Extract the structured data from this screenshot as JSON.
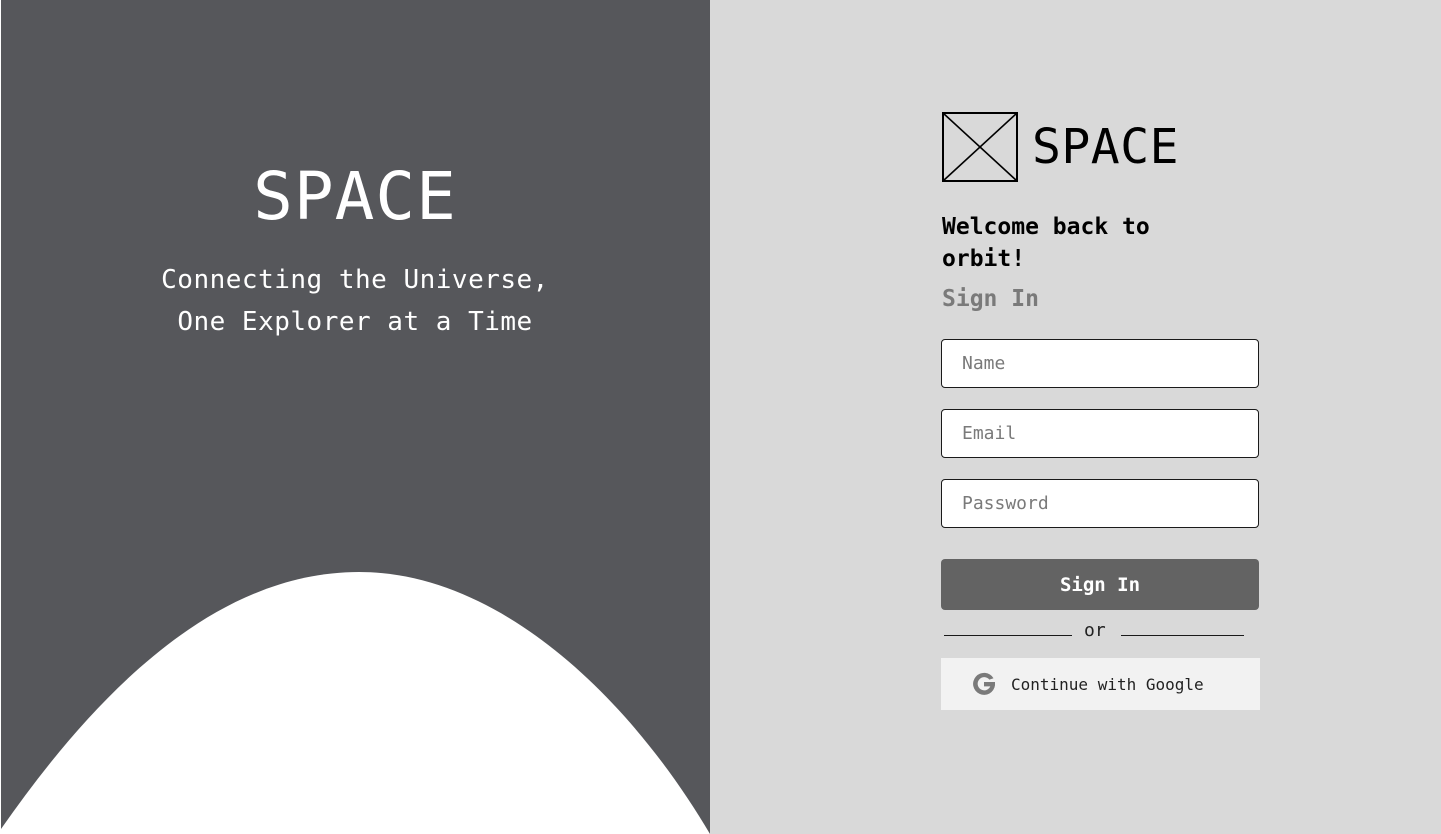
{
  "hero": {
    "title": "SPACE",
    "tagline_line1": "Connecting the Universe,",
    "tagline_line2": "One Explorer at a Time"
  },
  "brand": {
    "logo_icon": "image-placeholder-icon",
    "name": "SPACE"
  },
  "form": {
    "welcome": "Welcome back to orbit!",
    "heading": "Sign In",
    "name_placeholder": "Name",
    "email_placeholder": "Email",
    "password_placeholder": "Password",
    "submit_label": "Sign In",
    "divider_text": "or",
    "google_icon": "google-g-icon",
    "google_label": "Continue with Google"
  },
  "colors": {
    "left_panel": "#56575b",
    "right_panel": "#d9d9d9",
    "button": "#636363",
    "google_button": "#f2f2f2"
  }
}
